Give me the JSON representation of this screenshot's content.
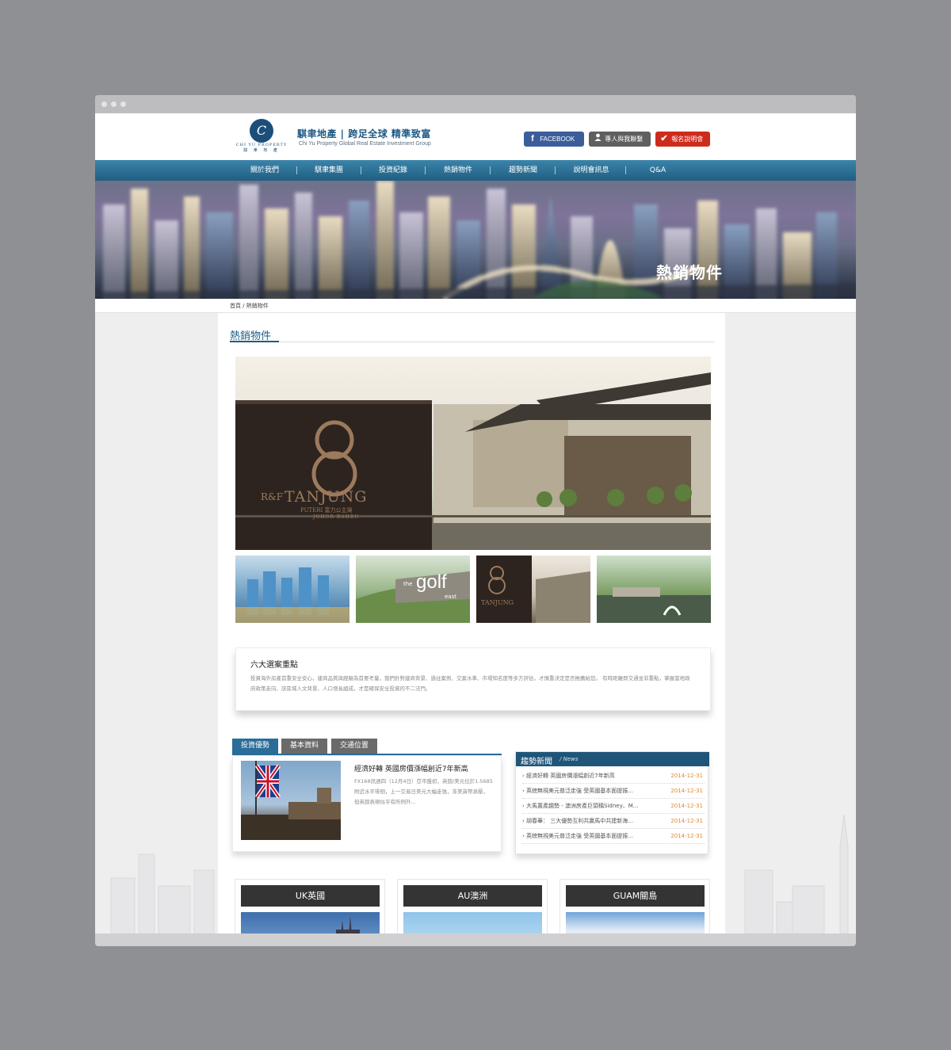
{
  "site": {
    "logo_letter": "C",
    "logo_en": "CHI YU PROPERTY",
    "logo_cn": "騏 聿 地 產",
    "brand_title": "騏聿地產 | 跨足全球 精準致富",
    "brand_sub": "Chi Yu Property Global Real Estate Investment Group"
  },
  "header_buttons": {
    "facebook": "FACEBOOK",
    "facebook_icon": "f",
    "contact": "專人與我聯繫",
    "signup": "報名說明會"
  },
  "nav": [
    "關於我們",
    "騏聿集團",
    "投資紀錄",
    "熱銷物件",
    "趨勢新聞",
    "說明會訊息",
    "Q&A"
  ],
  "banner": {
    "title": "熱銷物件"
  },
  "breadcrumb": "首頁 / 熱銷物件",
  "page_title": "熱銷物件",
  "hero": {
    "sign_brand": "R&F",
    "sign_name": "TANJUNG",
    "sign_sub": "PUTERI 富力公主灣",
    "sign_city": "JOHOR BAHRU"
  },
  "thumb_texts": {
    "golf": "golf",
    "golf_pre": "the",
    "golf_post": "east",
    "tanjung": "TANJUNG"
  },
  "feature": {
    "title": "六大選案重點",
    "body": "投資海外房產首重安全安心，建商品質與經驗為首要考量，我們針對建商背景、過往案例、交案水準、市場知名度等多方評估，才慎重決定是否推薦給您。 有時距離即交通並非重點，掌握當地政府政策走向、該區域人文背景、人口增長組成，才是確保安全投資的不二法門。"
  },
  "tabs": [
    "投資優勢",
    "基本資料",
    "交通位置"
  ],
  "article": {
    "title": "經濟好轉 英國房價漲幅創近7年新高",
    "body": "FX168訊週四（12月4日）亞市盤初，英鎊/美元位於1.5685附近水平徘徊，上一交易日美元大幅走強，非美貨幣承壓，但英鎊表現似乎有所例外..."
  },
  "news": {
    "title": "趨勢新聞",
    "subtitle": "/ News",
    "items": [
      {
        "text": "› 經濟好轉 英國房價漲幅創近7年新高",
        "date": "2014-12-31"
      },
      {
        "text": "› 英鎊無視美元普泛走強 受英國基本面提振...",
        "date": "2014-12-31"
      },
      {
        "text": "› 大馬置產趨勢 - 澳洲房產巨頭稱Sidney、M...",
        "date": "2014-12-31"
      },
      {
        "text": "› 胡春華： 三大優勢互利共贏馬中共建新海...",
        "date": "2014-12-31"
      },
      {
        "text": "› 英鎊無視美元普泛走強 受英國基本面提振...",
        "date": "2014-12-31"
      }
    ]
  },
  "regions": [
    "UK英國",
    "AU澳洲",
    "GUAM關島"
  ],
  "colors": {
    "brand_blue": "#1d5c86",
    "nav_blue": "#2a6d99",
    "facebook": "#3b5d9a",
    "signup_red": "#cf2b1c",
    "date_orange": "#e08a2e"
  }
}
